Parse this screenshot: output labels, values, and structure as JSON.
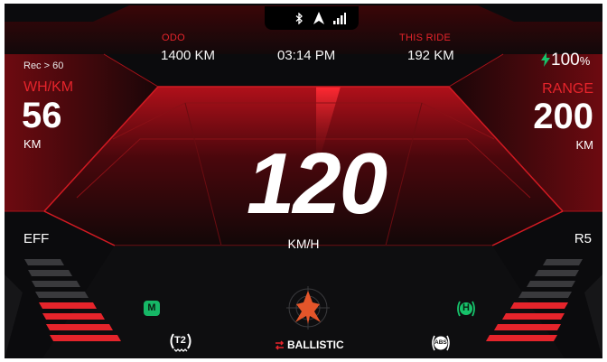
{
  "status_icons": [
    "bluetooth-icon",
    "navigation-arrow-icon",
    "signal-bars-icon"
  ],
  "odo": {
    "label": "ODO",
    "value": "1400 KM"
  },
  "clock": "03:14 PM",
  "this_ride": {
    "label": "THIS RIDE",
    "value": "192 KM"
  },
  "battery": {
    "icon": "lightning-icon",
    "value": "100",
    "unit": "%"
  },
  "recommendation": "Rec > 60",
  "efficiency": {
    "label": "WH/KM",
    "value": "56",
    "unit": "KM"
  },
  "range": {
    "label": "RANGE",
    "value": "200",
    "unit": "KM"
  },
  "speed": {
    "value": "120",
    "unit": "KM/H"
  },
  "eff_gauge": {
    "label": "EFF",
    "level": 0.5
  },
  "regen_gauge": {
    "label": "R5",
    "level": 0.5
  },
  "mode": {
    "label": "BALLISTIC",
    "icon": "ride-mode-icon"
  },
  "indicators": {
    "m_badge": "M",
    "tpms": "T2",
    "hill_hold": "H",
    "abs": "ABS"
  },
  "colors": {
    "accent": "#e5242b",
    "ok_green": "#16b766",
    "background": "#0b0b0d"
  }
}
